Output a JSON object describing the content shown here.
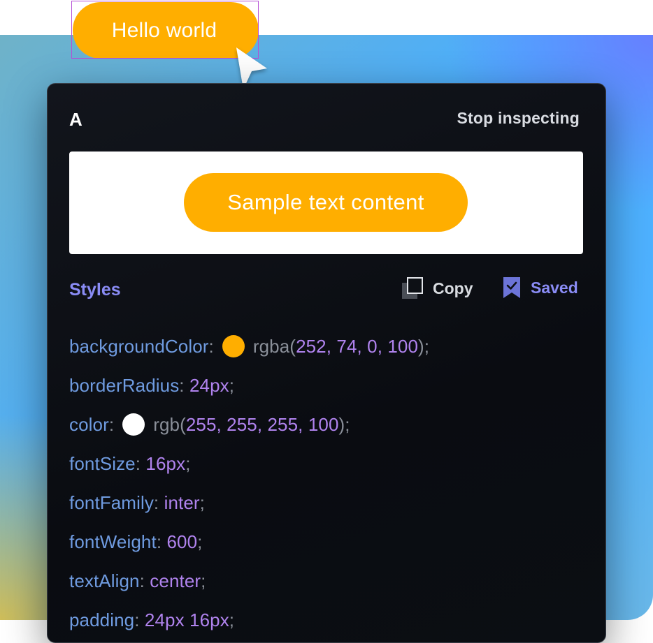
{
  "target_button": {
    "label": "Hello world",
    "color": "#ffae00"
  },
  "panel": {
    "title": "A",
    "stop_label": "Stop inspecting",
    "preview_label": "Sample text content",
    "styles_title": "Styles",
    "copy_label": "Copy",
    "saved_label": "Saved"
  },
  "colors": {
    "accent": "#8a8cf5",
    "key": "#6f9be0",
    "value": "#b083ee",
    "swatch_orange": "#ffae00",
    "swatch_white": "#ffffff"
  },
  "styles": [
    {
      "key": "backgroundColor",
      "fn": "rgba",
      "value": "252, 74, 0, 100",
      "swatch": "#ffae00"
    },
    {
      "key": "borderRadius",
      "value": "24px"
    },
    {
      "key": "color",
      "fn": "rgb",
      "value": "255, 255, 255, 100",
      "swatch": "#ffffff"
    },
    {
      "key": "fontSize",
      "value": "16px"
    },
    {
      "key": "fontFamily",
      "value": "inter"
    },
    {
      "key": "fontWeight",
      "value": "600"
    },
    {
      "key": "textAlign",
      "value": "center"
    },
    {
      "key": "padding",
      "value": "24px 16px"
    }
  ]
}
